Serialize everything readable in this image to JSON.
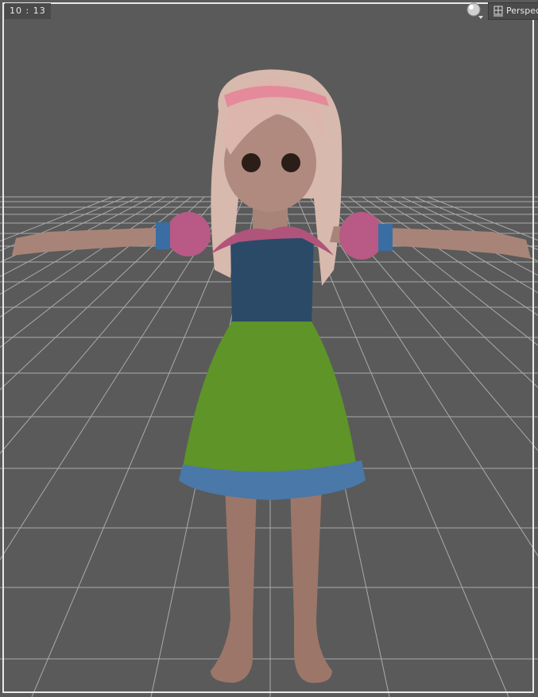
{
  "viewport": {
    "frame_label": "10 : 13",
    "camera_label": "Perspec",
    "background_color": "#5a5a5a",
    "icons": [
      "draw-style-sphere-icon",
      "camera-view-icon"
    ]
  }
}
